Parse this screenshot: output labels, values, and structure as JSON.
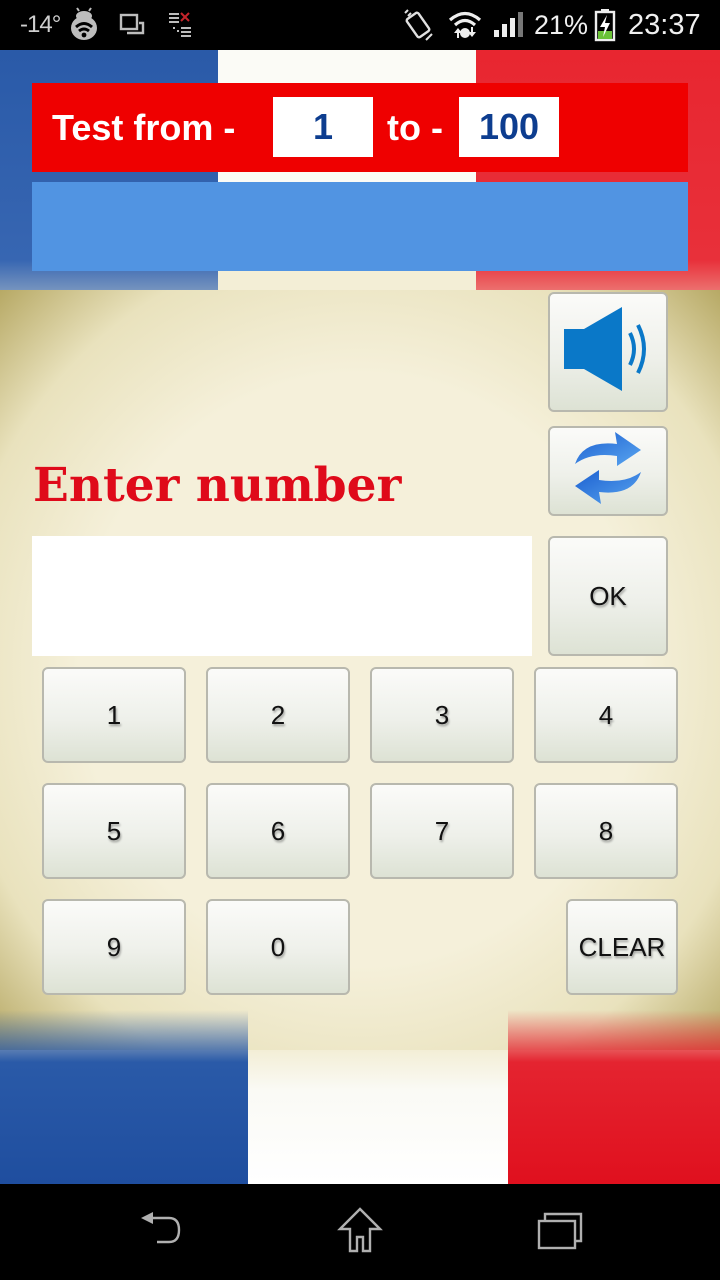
{
  "status_bar": {
    "temperature": "-14°",
    "icons_left": [
      "weather-temp",
      "debug-bug-icon",
      "screen-mirror-icon",
      "task-list-icon"
    ],
    "icons_right": [
      "vibrate-icon",
      "wifi-icon",
      "signal-icon",
      "battery-charging-icon"
    ],
    "battery_percent": "21%",
    "time": "23:37"
  },
  "header": {
    "from_label": "Test from -",
    "from_value": "1",
    "to_label": "to -",
    "to_value": "100"
  },
  "result_bar": {
    "text": ""
  },
  "controls": {
    "speaker_icon": "speaker-icon",
    "refresh_icon": "refresh-icon",
    "enter_label": "Enter number",
    "input_value": "",
    "input_placeholder": "",
    "ok_label": "OK"
  },
  "keypad": {
    "keys": [
      "1",
      "2",
      "3",
      "4",
      "5",
      "6",
      "7",
      "8",
      "9",
      "0"
    ],
    "clear_label": "CLEAR"
  },
  "colors": {
    "header_red": "#ef0000",
    "result_blue": "#5194e2",
    "range_text_blue": "#0d3d8f",
    "enter_label_red": "#df0a1a",
    "speaker_blue": "#0a78c8"
  },
  "nav_bar": {
    "buttons": [
      "back-icon",
      "home-icon",
      "recent-apps-icon"
    ]
  }
}
